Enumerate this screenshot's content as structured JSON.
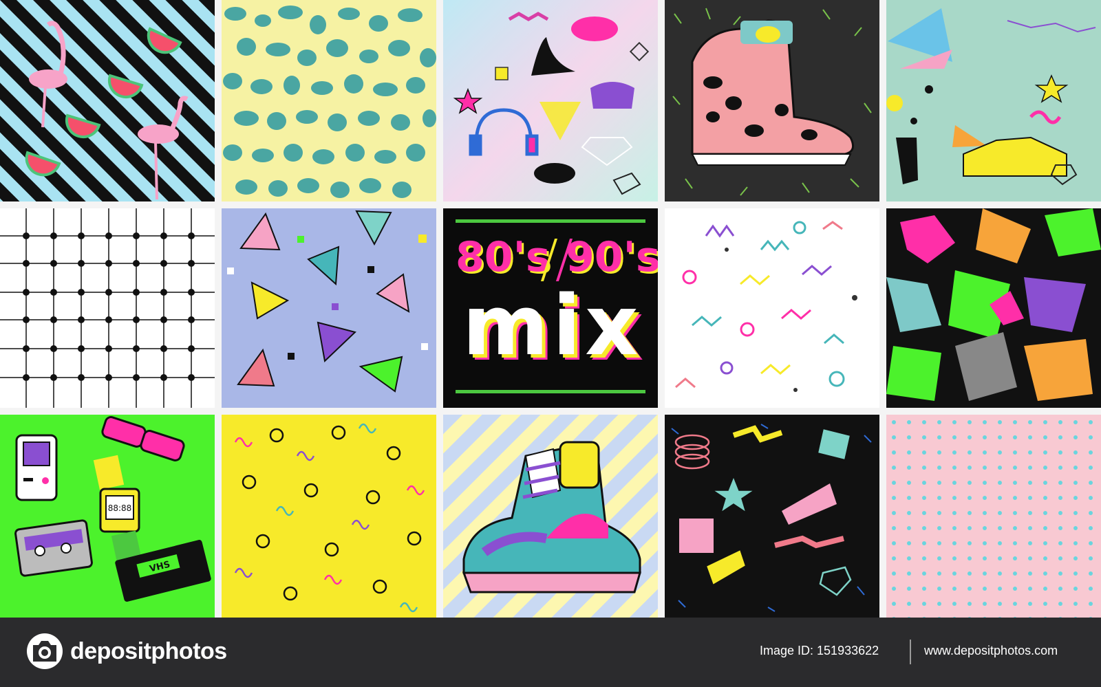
{
  "poster": {
    "title_80s": "80's",
    "title_90s": "90's",
    "title_mix": "mix"
  },
  "items": {
    "cassette_label": "",
    "vhs_label": "VHS",
    "watch_display": "88:88"
  },
  "footer": {
    "logo_text": "depositphotos",
    "image_id": "Image ID: 151933622",
    "website": "www.depositphotos.com"
  },
  "colors": {
    "footer_bg": "#2b2b2d",
    "neon_pink": "#ff2fa8",
    "neon_yellow": "#f7ea2a",
    "neon_green": "#4cf22c",
    "teal": "#46b6b9",
    "purple": "#8a4fd1",
    "sky_blue": "#9fd9f0"
  },
  "icons": [
    "flamingo-icon",
    "watermelon-icon",
    "sneaker-icon",
    "headphones-icon",
    "lipstick-lips-icon",
    "diamond-icon",
    "high-heel-icon",
    "purse-icon",
    "star-icon",
    "game-console-icon",
    "shutter-glasses-icon",
    "digital-watch-icon",
    "cassette-icon",
    "vhs-tape-icon",
    "camera-logo-icon"
  ]
}
